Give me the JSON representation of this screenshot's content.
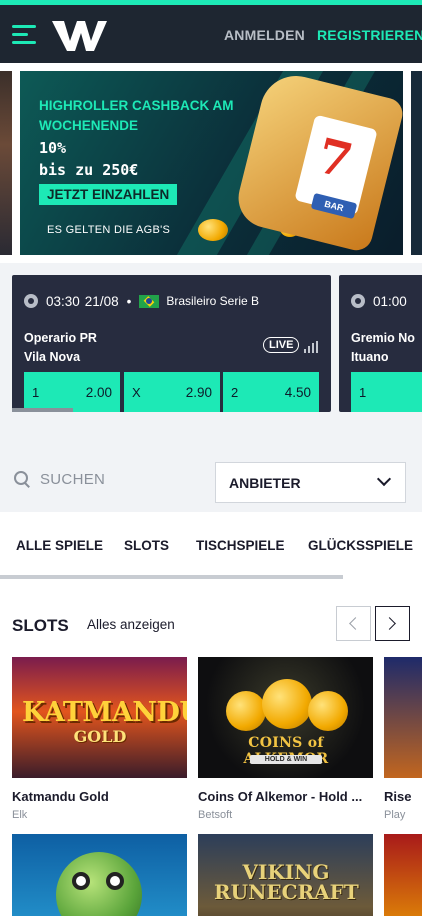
{
  "header": {
    "menu_icon": "hamburger-menu-icon",
    "logo_letter": "W",
    "login_label": "ANMELDEN",
    "register_label": "REGISTRIEREN",
    "accent_color": "#1de9b6",
    "bg_color": "#1e2631"
  },
  "promo": {
    "title": "HIGHROLLER CASHBACK AM WOCHENENDE",
    "amount_line1": "10%",
    "amount_line2": "bis zu 250€",
    "cta_label": "JETZT EINZAHLEN",
    "note": "ES GELTEN DIE AGB'S",
    "slot_symbol": "7",
    "bar_symbol": "BAR"
  },
  "matches": [
    {
      "time": "03:30",
      "date": "21/08",
      "separator": "•",
      "league": "Brasileiro Serie B",
      "home": "Operario PR",
      "away": "Vila Nova",
      "live_label": "LIVE",
      "odds": [
        {
          "label": "1",
          "value": "2.00"
        },
        {
          "label": "X",
          "value": "2.90"
        },
        {
          "label": "2",
          "value": "4.50"
        }
      ]
    },
    {
      "time": "01:00",
      "home": "Gremio No",
      "away": "Ituano",
      "odds": [
        {
          "label": "1",
          "value": ""
        }
      ]
    }
  ],
  "search": {
    "label": "SUCHEN",
    "icon": "search-icon"
  },
  "provider_select": {
    "label": "ANBIETER",
    "icon": "chevron-down-icon"
  },
  "category_tabs": [
    {
      "label": "ALLE SPIELE"
    },
    {
      "label": "SLOTS"
    },
    {
      "label": "TISCHSPIELE"
    },
    {
      "label": "GLÜCKSSPIELE"
    }
  ],
  "slots_section": {
    "title": "SLOTS",
    "see_all": "Alles anzeigen"
  },
  "games": [
    {
      "name": "Katmandu Gold",
      "provider": "Elk",
      "logo": "KATMANDU",
      "logo2": "GOLD"
    },
    {
      "name": "Coins Of Alkemor - Hold ...",
      "provider": "Betsoft",
      "logo": "COINS of ALKEMOR",
      "logo2": "HOLD & WIN"
    },
    {
      "name": "Rise",
      "provider": "Play"
    }
  ],
  "games_row2": [
    {
      "logo": ""
    },
    {
      "logo": "VIKING RUNECRAFT"
    }
  ]
}
